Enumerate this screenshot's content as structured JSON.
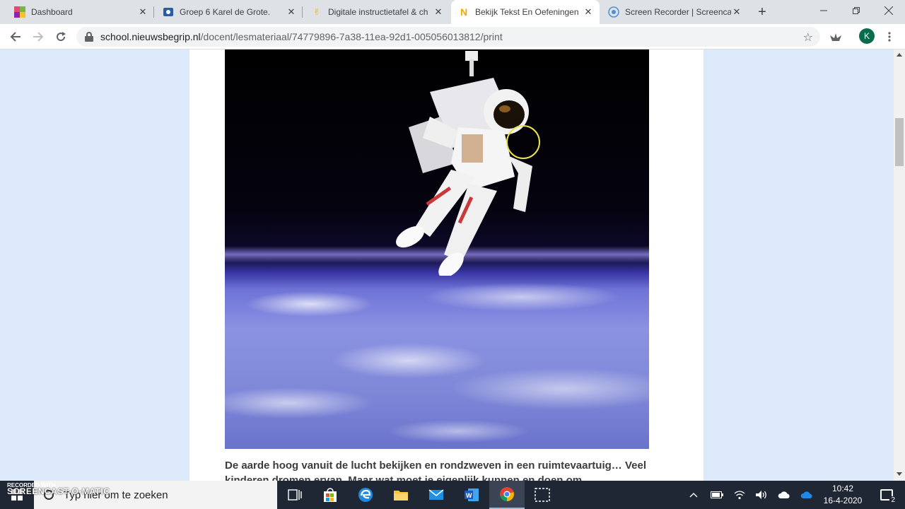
{
  "browser": {
    "tabs": [
      {
        "title": "Dashboard",
        "favicon": "dashboard-icon",
        "active": false
      },
      {
        "title": "Groep 6 Karel de Grote.",
        "favicon": "school-icon",
        "active": false
      },
      {
        "title": "Digitale instructietafel & ch",
        "favicon": "hand-icon",
        "active": false
      },
      {
        "title": "Bekijk Tekst En Oefeningen",
        "favicon": "nieuwsbegrip-icon",
        "active": true
      },
      {
        "title": "Screen Recorder | Screenca",
        "favicon": "record-icon",
        "active": false
      }
    ],
    "url": {
      "host": "school.nieuwsbegrip.nl",
      "path": "/docent/lesmateriaal/74779896-7a38-11ea-92d1-005056013812/print"
    },
    "profile_initial": "K"
  },
  "article": {
    "caption": "De aarde hoog vanuit de lucht bekijken en rondzweven in een ruimtevaartuig… Veel kinderen dromen ervan. Maar wat moet je eigenlijk kunnen en doen om"
  },
  "taskbar": {
    "search_placeholder": "Typ hier om te zoeken",
    "watermark_top": "RECORDED WITH",
    "watermark_brand": "SCREENCAST-O-MATIC",
    "time": "10:42",
    "date": "16-4-2020",
    "notification_count": "2"
  }
}
